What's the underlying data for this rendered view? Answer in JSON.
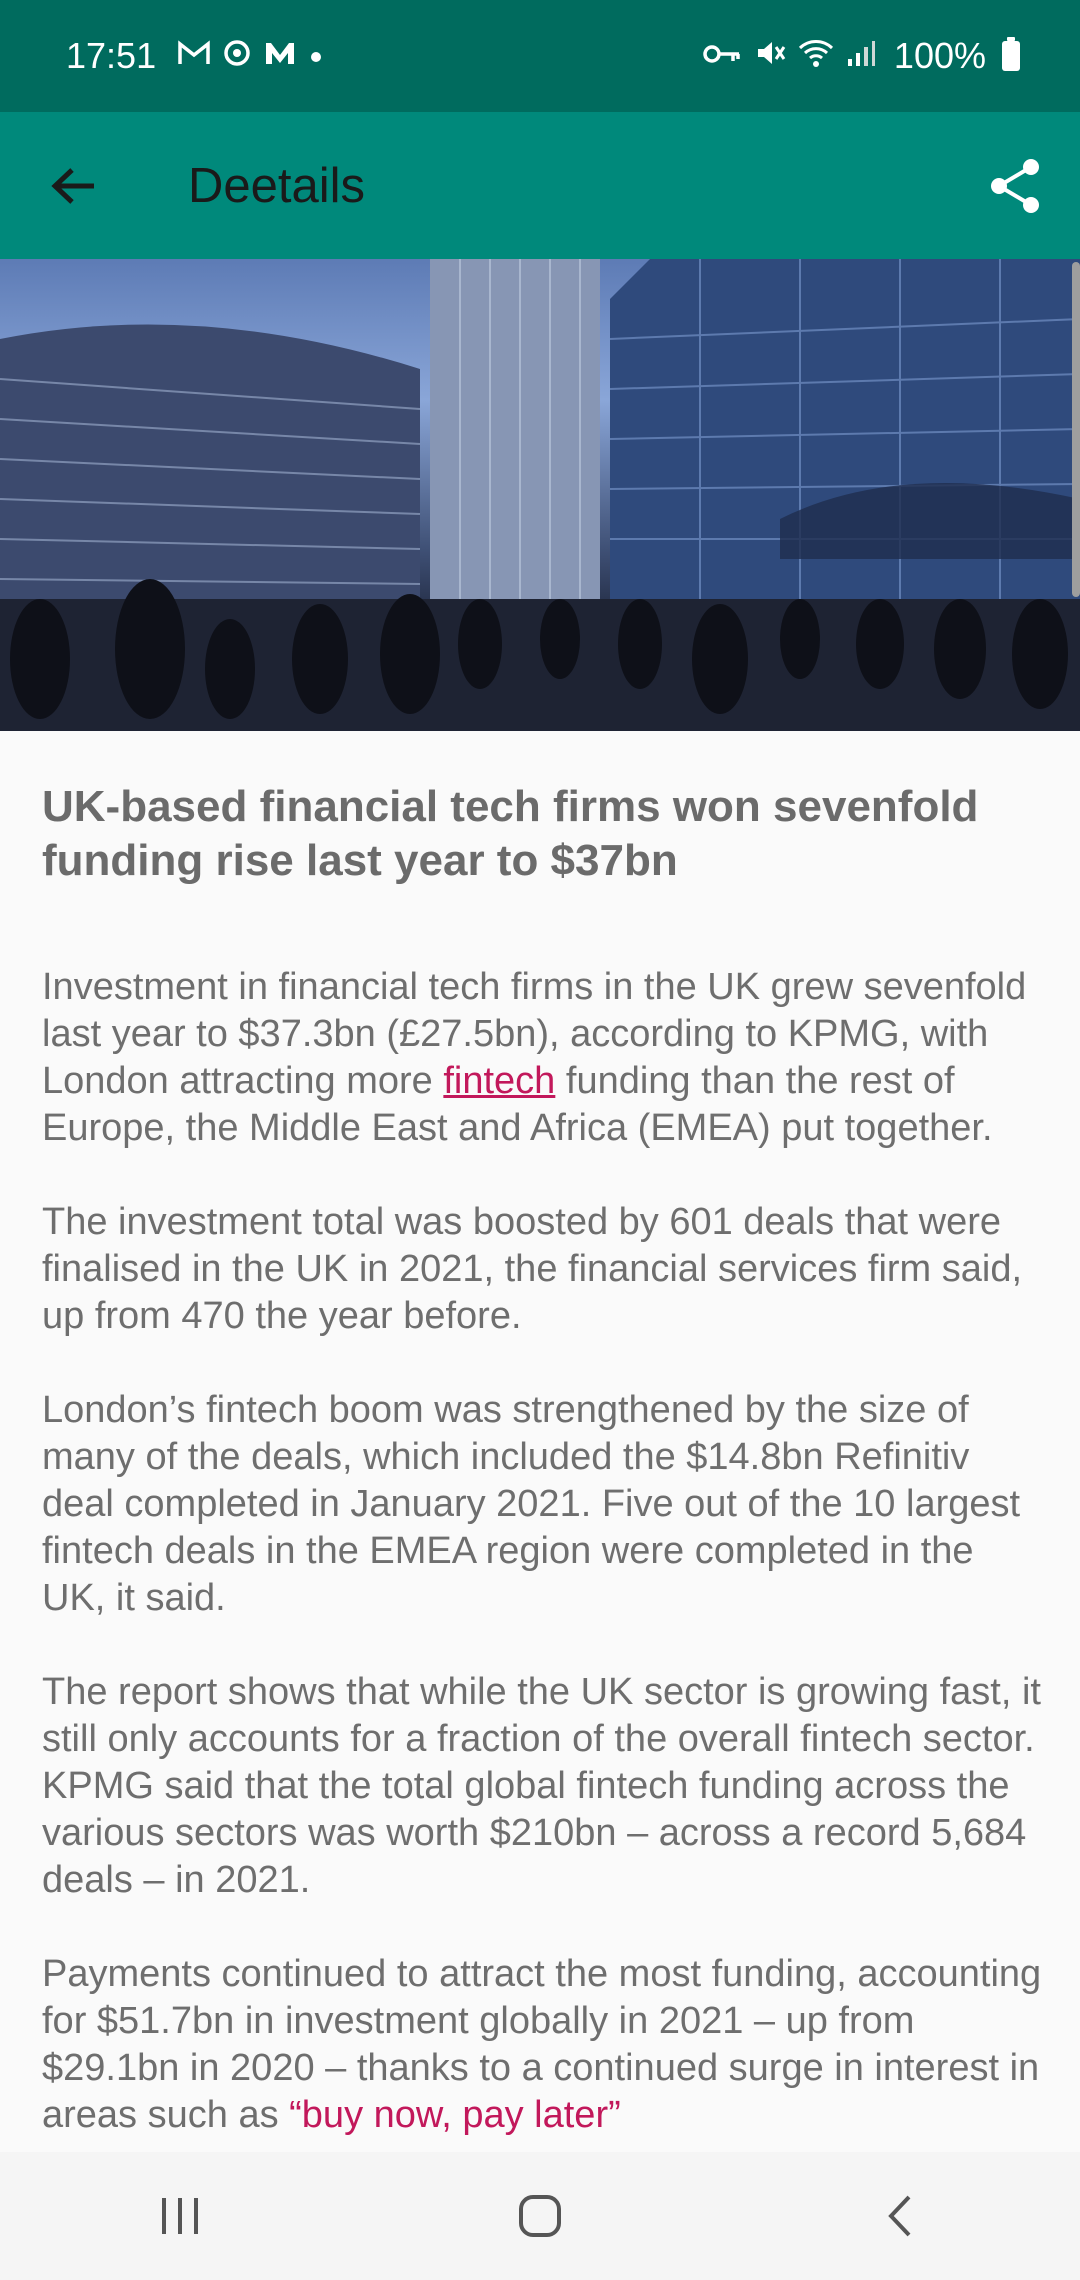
{
  "status_bar": {
    "time": "17:51",
    "left_icons": [
      "gmail-icon",
      "sync-icon",
      "m-app-icon",
      "dot-icon"
    ],
    "right_icons": [
      "vpn-key-icon",
      "mute-icon",
      "wifi-icon",
      "signal-icon"
    ],
    "battery": "100%",
    "background": "#006b5e"
  },
  "app_bar": {
    "title": "Deetails",
    "background": "#00897b"
  },
  "article": {
    "title": "UK-based financial tech firms won sevenfold funding rise last year to $37bn",
    "p1_before_link": "Investment in financial tech firms in the UK grew sevenfold last year to $37.3bn (£27.5bn), according to KPMG, with London attracting more ",
    "p1_link": "fintech",
    "p1_after_link": " funding than the rest of Europe, the Middle East and Africa (EMEA) put together.",
    "p2": "The investment total was boosted by 601 deals that were finalised in the UK in 2021, the financial services firm said, up from 470 the year before.",
    "p3": "London’s fintech boom was strengthened by the size of many of the deals, which included the $14.8bn Refinitiv deal completed in January 2021. Five out of the 10 largest fintech deals in the EMEA region were completed in the UK, it said.",
    "p4": "The report shows that while the UK sector is growing fast, it still only accounts for a fraction of the overall fintech sector. KPMG said that the total global fintech funding across the various sectors was worth $210bn – across a record 5,684 deals – in 2021.",
    "p5_before_link": "Payments continued to attract the most funding, accounting for $51.7bn in investment globally in 2021 – up from $29.1bn in 2020 – thanks to a continued surge in interest in areas such as ",
    "p5_link": "“buy now, pay later”",
    "link_color": "#c2185b"
  },
  "nav_bar": {
    "buttons": [
      "recent-apps-icon",
      "home-icon",
      "back-icon"
    ]
  }
}
